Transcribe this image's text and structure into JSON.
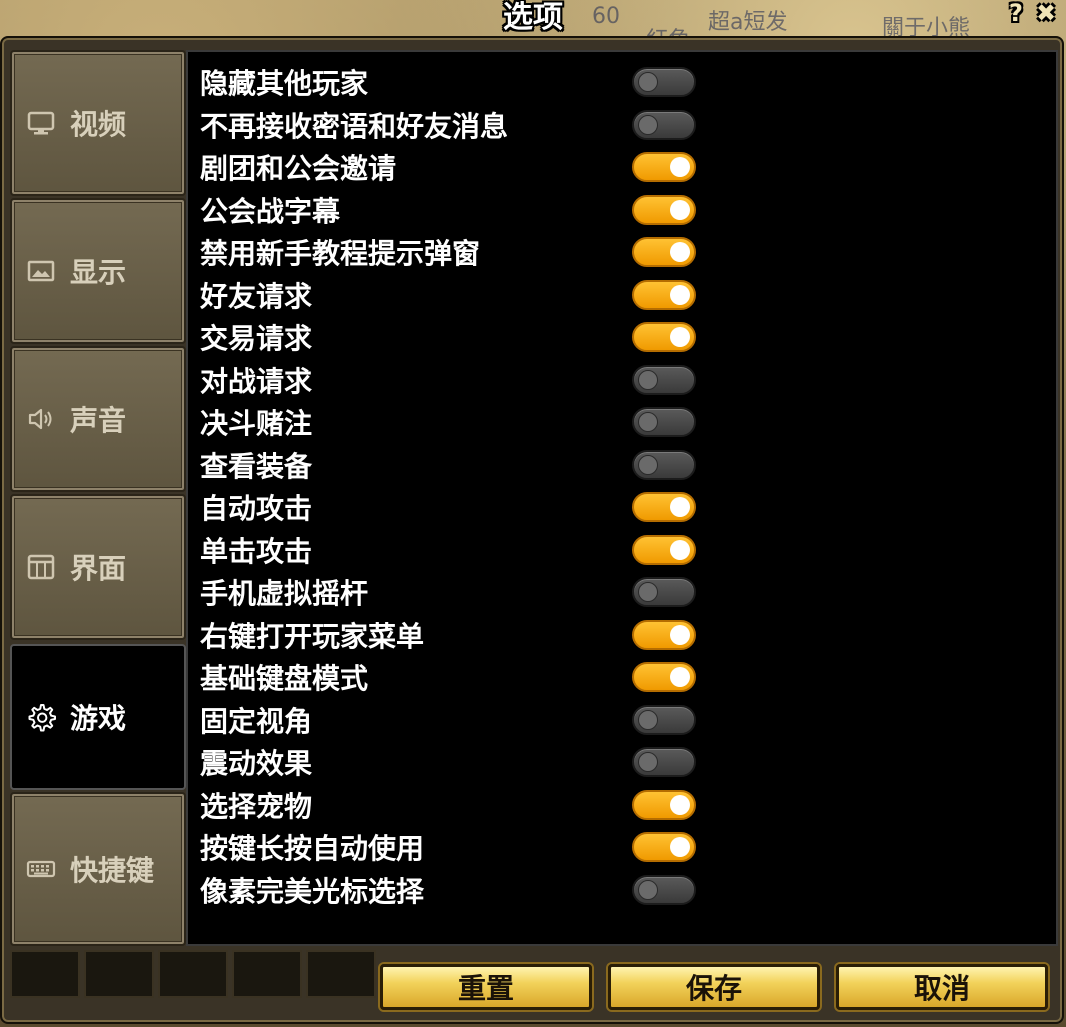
{
  "dialog": {
    "title": "选项",
    "help_glyph": "?",
    "close_glyph": "✖"
  },
  "background_names": [
    "超a短发",
    "關于小熊",
    "紅角",
    "60"
  ],
  "tabs": [
    {
      "label": "视频",
      "icon": "monitor-icon",
      "active": false
    },
    {
      "label": "显示",
      "icon": "image-icon",
      "active": false
    },
    {
      "label": "声音",
      "icon": "speaker-icon",
      "active": false
    },
    {
      "label": "界面",
      "icon": "window-icon",
      "active": false
    },
    {
      "label": "游戏",
      "icon": "gear-icon",
      "active": true
    },
    {
      "label": "快捷键",
      "icon": "keyboard-icon",
      "active": false
    }
  ],
  "options": [
    {
      "label": "隐藏其他玩家",
      "enabled": false
    },
    {
      "label": "不再接收密语和好友消息",
      "enabled": false
    },
    {
      "label": "剧团和公会邀请",
      "enabled": true
    },
    {
      "label": "公会战字幕",
      "enabled": true
    },
    {
      "label": "禁用新手教程提示弹窗",
      "enabled": true
    },
    {
      "label": "好友请求",
      "enabled": true
    },
    {
      "label": "交易请求",
      "enabled": true
    },
    {
      "label": "对战请求",
      "enabled": false
    },
    {
      "label": "决斗赌注",
      "enabled": false
    },
    {
      "label": "查看装备",
      "enabled": false
    },
    {
      "label": "自动攻击",
      "enabled": true
    },
    {
      "label": "单击攻击",
      "enabled": true
    },
    {
      "label": "手机虚拟摇杆",
      "enabled": false
    },
    {
      "label": "右键打开玩家菜单",
      "enabled": true
    },
    {
      "label": "基础键盘模式",
      "enabled": true
    },
    {
      "label": "固定视角",
      "enabled": false
    },
    {
      "label": "震动效果",
      "enabled": false
    },
    {
      "label": "选择宠物",
      "enabled": true
    },
    {
      "label": "按键长按自动使用",
      "enabled": true
    },
    {
      "label": "像素完美光标选择",
      "enabled": false
    }
  ],
  "buttons": {
    "reset": "重置",
    "save": "保存",
    "cancel": "取消"
  },
  "colors": {
    "toggle_on": "#f5a800",
    "toggle_off": "#4a4a4a",
    "panel_bg": "#000000",
    "button_gold": "#f2d25a"
  }
}
